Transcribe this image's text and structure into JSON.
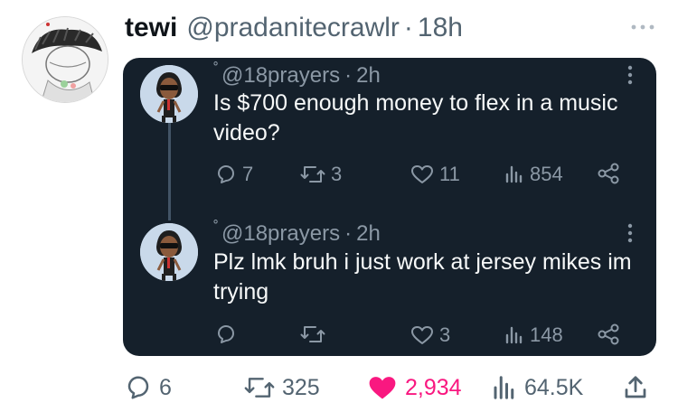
{
  "tweet": {
    "display_name": "tewi",
    "handle": "@pradanitecrawlr",
    "separator": "·",
    "time": "18h",
    "actions": {
      "replies": "6",
      "retweets": "325",
      "likes": "2,934",
      "views": "64.5K"
    },
    "liked": true
  },
  "quoted_thread": [
    {
      "handle": "@18prayers",
      "separator": "·",
      "time": "2h",
      "text": "Is $700 enough money to flex in a music video?",
      "replies": "7",
      "retweets": "3",
      "likes": "11",
      "views": "854"
    },
    {
      "handle": "@18prayers",
      "separator": "·",
      "time": "2h",
      "text": "Plz lmk bruh i just work at jersey mikes im trying",
      "replies": "",
      "retweets": "",
      "likes": "3",
      "views": "148"
    }
  ],
  "colors": {
    "background": "#ffffff",
    "card": "#15202b",
    "card_text": "#f7f9f9",
    "secondary": "#536471",
    "card_secondary": "#8b98a5",
    "like": "#f91880"
  },
  "icons": [
    "reply-icon",
    "retweet-icon",
    "like-icon",
    "views-icon",
    "share-icon",
    "more-icon"
  ]
}
